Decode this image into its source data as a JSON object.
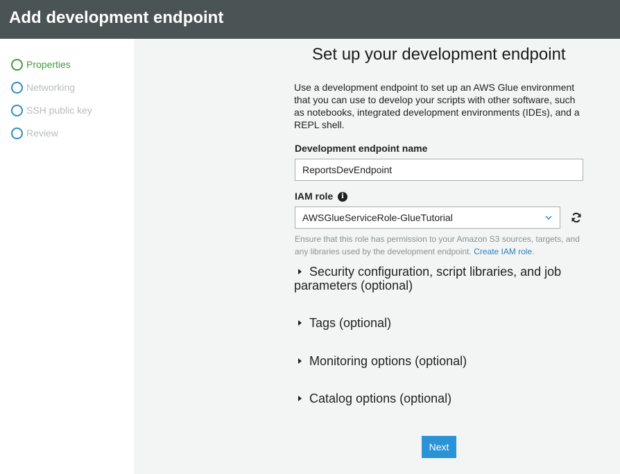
{
  "header": {
    "title": "Add development endpoint"
  },
  "sidebar": {
    "steps": [
      {
        "label": "Properties"
      },
      {
        "label": "Networking"
      },
      {
        "label": "SSH public key"
      },
      {
        "label": "Review"
      }
    ]
  },
  "main": {
    "title": "Set up your development endpoint",
    "intro": "Use a development endpoint to set up an AWS Glue environment that you can use to develop your scripts with other software, such as notebooks, integrated development environments (IDEs), and a REPL shell.",
    "endpoint_name_label": "Development endpoint name",
    "endpoint_name_value": "ReportsDevEndpoint",
    "iam_role_label": "IAM role",
    "iam_role_value": "AWSGlueServiceRole-GlueTutorial",
    "iam_hint": "Ensure that this role has permission to your Amazon S3 sources, targets, and any libraries used by the development endpoint.",
    "iam_hint_link": "Create IAM role",
    "iam_hint_end": ".",
    "sections": [
      {
        "label": "Security configuration, script libraries, and job parameters (optional)"
      },
      {
        "label": "Tags (optional)"
      },
      {
        "label": "Monitoring options (optional)"
      },
      {
        "label": "Catalog options (optional)"
      }
    ],
    "next_label": "Next"
  },
  "colors": {
    "header_bg": "#4a5455",
    "active_step": "#3f9b3c",
    "inactive_ring": "#2e8dc0",
    "primary_button": "#2a93d5",
    "link": "#2a7fbf"
  },
  "icons": {
    "info": "info-icon",
    "dropdown": "chevron-down-icon",
    "refresh": "refresh-icon",
    "section_toggle": "caret-right-icon",
    "step_status": "circle-icon"
  }
}
